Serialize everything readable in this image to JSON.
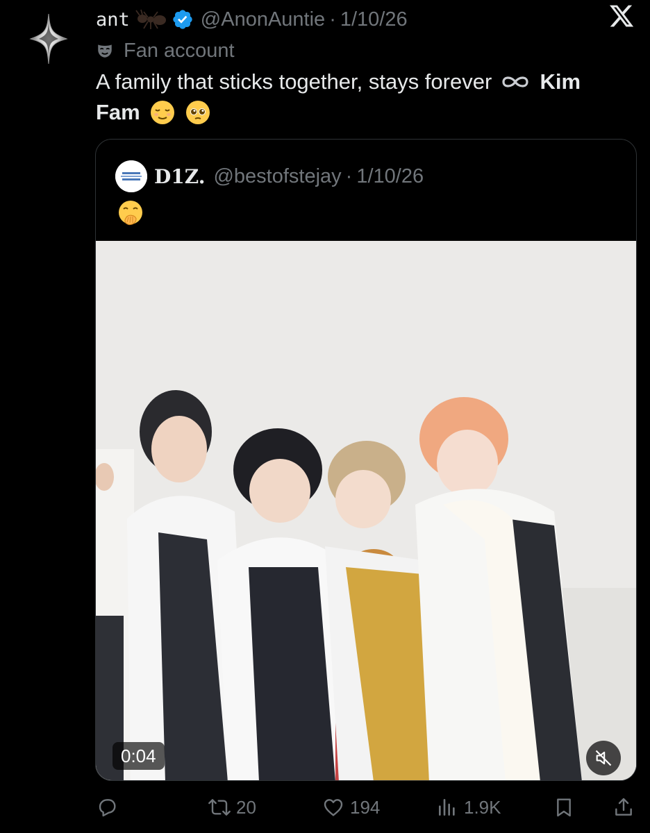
{
  "tweet": {
    "author_name": "ant",
    "handle": "@AnonAuntie",
    "separator": "·",
    "date": "1/10/26",
    "label": "Fan account",
    "text_main": "A family that sticks together, stays forever",
    "text_bold_1": "Kim",
    "text_bold_2": "Fam",
    "icons": [
      "sparkle-avatar-icon",
      "ant-emoji-icon",
      "verified-badge-icon",
      "x-logo-icon",
      "mask-icon",
      "infinity-icon",
      "relieved-face-emoji-icon",
      "pleading-face-emoji-icon"
    ]
  },
  "quote": {
    "author_name": "D1Z.",
    "handle": "@bestofstejay",
    "separator": "·",
    "date": "1/10/26",
    "emoji": "hand-over-mouth-emoji-icon",
    "video": {
      "time": "0:04",
      "muted": true
    }
  },
  "actions": {
    "reply_count": "",
    "repost_count": "20",
    "like_count": "194",
    "views_count": "1.9K"
  },
  "colors": {
    "background": "#000000",
    "text_primary": "#e7e9ea",
    "text_secondary": "#71767b",
    "verified_blue": "#1d9bf0",
    "border": "#2f3336"
  }
}
